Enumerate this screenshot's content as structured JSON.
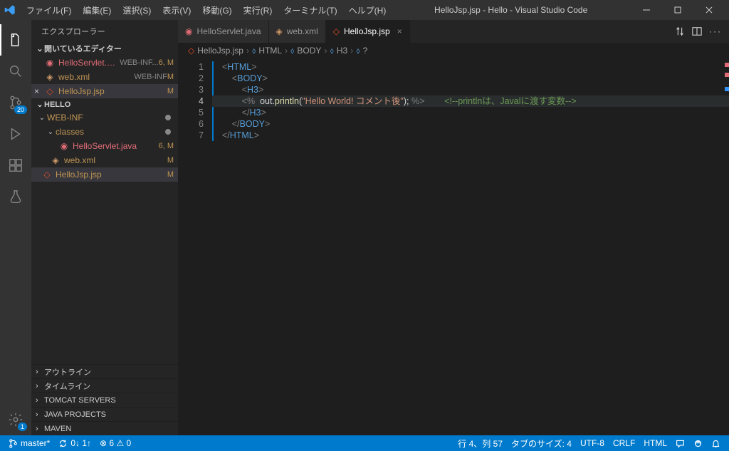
{
  "window": {
    "title": "HelloJsp.jsp - Hello - Visual Studio Code"
  },
  "menu": {
    "file": "ファイル(F)",
    "edit": "編集(E)",
    "select": "選択(S)",
    "view": "表示(V)",
    "go": "移動(G)",
    "run": "実行(R)",
    "terminal": "ターミナル(T)",
    "help": "ヘルプ(H)"
  },
  "activity": {
    "scm_badge": "20",
    "settings_badge": "1"
  },
  "sidebar": {
    "title": "エクスプローラー",
    "open_editors": "開いているエディター",
    "folder": "HELLO",
    "editors": [
      {
        "name": "HelloServlet.java",
        "suffix": "WEB-INF...",
        "right": "6, M",
        "error": true
      },
      {
        "name": "web.xml",
        "suffix": "WEB-INF",
        "right": "M",
        "modified": true
      },
      {
        "name": "HelloJsp.jsp",
        "suffix": "",
        "right": "M",
        "selected": true,
        "modified": true,
        "close": true
      }
    ],
    "tree": {
      "webinf": "WEB-INF",
      "classes": "classes",
      "servlet": {
        "name": "HelloServlet.java",
        "right": "6, M"
      },
      "webxml": {
        "name": "web.xml",
        "right": "M"
      },
      "jsp": {
        "name": "HelloJsp.jsp",
        "right": "M"
      }
    },
    "panels": {
      "outline": "アウトライン",
      "timeline": "タイムライン",
      "tomcat": "TOMCAT SERVERS",
      "java": "JAVA PROJECTS",
      "maven": "MAVEN"
    }
  },
  "tabs": [
    {
      "name": "HelloServlet.java",
      "icon": "java",
      "error": true
    },
    {
      "name": "web.xml",
      "icon": "xml",
      "modified": true
    },
    {
      "name": "HelloJsp.jsp",
      "icon": "html",
      "active": true
    }
  ],
  "breadcrumb": {
    "file": "HelloJsp.jsp",
    "p1": "HTML",
    "p2": "BODY",
    "p3": "H3",
    "p4": "?"
  },
  "code": {
    "l1a": "<",
    "l1b": "HTML",
    "l1c": ">",
    "l2a": "<",
    "l2b": "BODY",
    "l2c": ">",
    "l3a": "<",
    "l3b": "H3",
    "l3c": ">",
    "l4a": "<%",
    "l4sp": "  ",
    "l4b": "out.",
    "l4fn": "println",
    "l4c": "(",
    "l4str": "\"Hello World! コメント後\"",
    "l4d": "); ",
    "l4e": "%>",
    "l4pad": "        ",
    "l4com": "<!--printlnは、Javalに渡す変数-->",
    "l5a": "</",
    "l5b": "H3",
    "l5c": ">",
    "l6a": "</",
    "l6b": "BODY",
    "l6c": ">",
    "l7a": "</",
    "l7b": "HTML",
    "l7c": ">"
  },
  "status": {
    "branch": "master*",
    "sync": "0↓ 1↑",
    "problems": "⊗ 6  ⚠ 0",
    "cursor": "行 4、列 57",
    "tabsize": "タブのサイズ: 4",
    "encoding": "UTF-8",
    "eol": "CRLF",
    "lang": "HTML"
  }
}
